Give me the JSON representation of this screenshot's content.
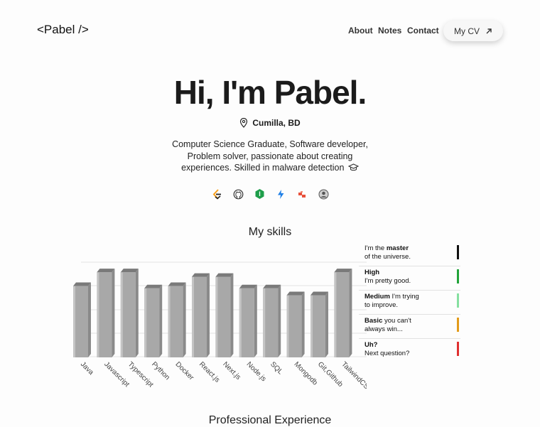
{
  "header": {
    "logo": "<Pabel />",
    "nav": [
      "About",
      "Notes",
      "Contact"
    ],
    "cv_label": "My CV"
  },
  "hero": {
    "title": "Hi, I'm Pabel.",
    "location": "Cumilla, BD",
    "bio": "Computer Science Graduate, Software developer, Problem solver, passionate about creating experiences. Skilled in malware detection"
  },
  "socials": [
    "leetcode-icon",
    "github-icon",
    "nodejs-icon",
    "bolt-icon",
    "codeforces-icon",
    "avatar-icon"
  ],
  "skills": {
    "title": "My skills",
    "levels": [
      {
        "bold": "",
        "pre": "I'm the ",
        "strong": "master",
        "line2": "of the universe.",
        "color": "#111111"
      },
      {
        "strong": "High",
        "pre": "",
        "line1rest": "",
        "line2": "I'm pretty good.",
        "color": "#22a33a"
      },
      {
        "strong": "Medium",
        "line1rest": " I'm trying",
        "line2": "to improve.",
        "color": "#86e0a0"
      },
      {
        "strong": "Basic",
        "line1rest": " you can't",
        "line2": "always win...",
        "color": "#e39b1a"
      },
      {
        "strong": "Uh?",
        "line1rest": "",
        "line2": "Next question?",
        "color": "#e03030"
      }
    ]
  },
  "chart_data": {
    "type": "bar",
    "categories": [
      "Java",
      "Javascript",
      "Typescript",
      "Python",
      "Docker",
      "React.js",
      "Next.js",
      "Node.js",
      "SQL",
      "Mongodb",
      "Git,Github",
      "TailwindCSS"
    ],
    "values": [
      3.1,
      3.7,
      3.7,
      3.0,
      3.1,
      3.5,
      3.5,
      3.0,
      3.0,
      2.7,
      2.7,
      3.7
    ],
    "ylim": [
      0,
      5
    ],
    "bar_color": "#a8a8a8"
  },
  "experience": {
    "title": "Professional Experience"
  }
}
